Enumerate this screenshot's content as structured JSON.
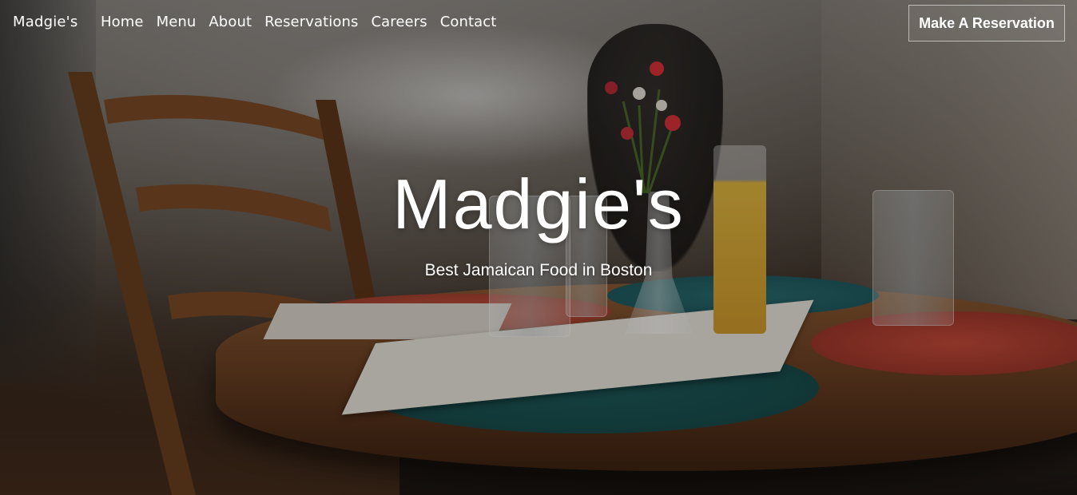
{
  "brand": "Madgie's",
  "nav": {
    "items": [
      {
        "label": "Home"
      },
      {
        "label": "Menu"
      },
      {
        "label": "About"
      },
      {
        "label": "Reservations"
      },
      {
        "label": "Careers"
      },
      {
        "label": "Contact"
      }
    ],
    "cta_label": "Make A Reservation"
  },
  "hero": {
    "title": "Madgie's",
    "subtitle": "Best Jamaican Food in Boston"
  },
  "colors": {
    "text": "#ffffff",
    "placemat_teal": "#1f5a5a",
    "placemat_red": "#c44a3a",
    "table_wood": "#6b4023"
  }
}
